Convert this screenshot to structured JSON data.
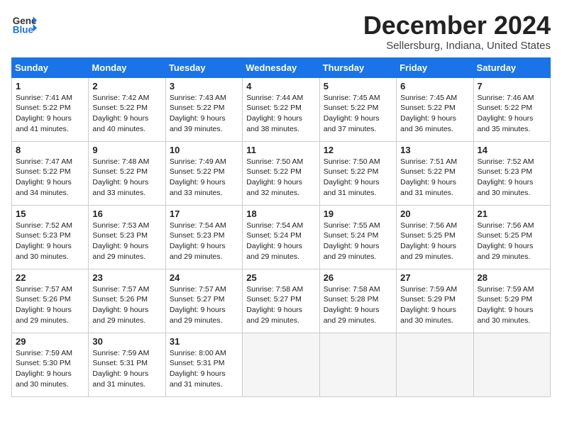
{
  "header": {
    "logo_line1": "General",
    "logo_line2": "Blue",
    "month": "December 2024",
    "location": "Sellersburg, Indiana, United States"
  },
  "weekdays": [
    "Sunday",
    "Monday",
    "Tuesday",
    "Wednesday",
    "Thursday",
    "Friday",
    "Saturday"
  ],
  "weeks": [
    [
      {
        "day": "1",
        "lines": [
          "Sunrise: 7:41 AM",
          "Sunset: 5:22 PM",
          "Daylight: 9 hours",
          "and 41 minutes."
        ]
      },
      {
        "day": "2",
        "lines": [
          "Sunrise: 7:42 AM",
          "Sunset: 5:22 PM",
          "Daylight: 9 hours",
          "and 40 minutes."
        ]
      },
      {
        "day": "3",
        "lines": [
          "Sunrise: 7:43 AM",
          "Sunset: 5:22 PM",
          "Daylight: 9 hours",
          "and 39 minutes."
        ]
      },
      {
        "day": "4",
        "lines": [
          "Sunrise: 7:44 AM",
          "Sunset: 5:22 PM",
          "Daylight: 9 hours",
          "and 38 minutes."
        ]
      },
      {
        "day": "5",
        "lines": [
          "Sunrise: 7:45 AM",
          "Sunset: 5:22 PM",
          "Daylight: 9 hours",
          "and 37 minutes."
        ]
      },
      {
        "day": "6",
        "lines": [
          "Sunrise: 7:45 AM",
          "Sunset: 5:22 PM",
          "Daylight: 9 hours",
          "and 36 minutes."
        ]
      },
      {
        "day": "7",
        "lines": [
          "Sunrise: 7:46 AM",
          "Sunset: 5:22 PM",
          "Daylight: 9 hours",
          "and 35 minutes."
        ]
      }
    ],
    [
      {
        "day": "8",
        "lines": [
          "Sunrise: 7:47 AM",
          "Sunset: 5:22 PM",
          "Daylight: 9 hours",
          "and 34 minutes."
        ]
      },
      {
        "day": "9",
        "lines": [
          "Sunrise: 7:48 AM",
          "Sunset: 5:22 PM",
          "Daylight: 9 hours",
          "and 33 minutes."
        ]
      },
      {
        "day": "10",
        "lines": [
          "Sunrise: 7:49 AM",
          "Sunset: 5:22 PM",
          "Daylight: 9 hours",
          "and 33 minutes."
        ]
      },
      {
        "day": "11",
        "lines": [
          "Sunrise: 7:50 AM",
          "Sunset: 5:22 PM",
          "Daylight: 9 hours",
          "and 32 minutes."
        ]
      },
      {
        "day": "12",
        "lines": [
          "Sunrise: 7:50 AM",
          "Sunset: 5:22 PM",
          "Daylight: 9 hours",
          "and 31 minutes."
        ]
      },
      {
        "day": "13",
        "lines": [
          "Sunrise: 7:51 AM",
          "Sunset: 5:22 PM",
          "Daylight: 9 hours",
          "and 31 minutes."
        ]
      },
      {
        "day": "14",
        "lines": [
          "Sunrise: 7:52 AM",
          "Sunset: 5:23 PM",
          "Daylight: 9 hours",
          "and 30 minutes."
        ]
      }
    ],
    [
      {
        "day": "15",
        "lines": [
          "Sunrise: 7:52 AM",
          "Sunset: 5:23 PM",
          "Daylight: 9 hours",
          "and 30 minutes."
        ]
      },
      {
        "day": "16",
        "lines": [
          "Sunrise: 7:53 AM",
          "Sunset: 5:23 PM",
          "Daylight: 9 hours",
          "and 29 minutes."
        ]
      },
      {
        "day": "17",
        "lines": [
          "Sunrise: 7:54 AM",
          "Sunset: 5:23 PM",
          "Daylight: 9 hours",
          "and 29 minutes."
        ]
      },
      {
        "day": "18",
        "lines": [
          "Sunrise: 7:54 AM",
          "Sunset: 5:24 PM",
          "Daylight: 9 hours",
          "and 29 minutes."
        ]
      },
      {
        "day": "19",
        "lines": [
          "Sunrise: 7:55 AM",
          "Sunset: 5:24 PM",
          "Daylight: 9 hours",
          "and 29 minutes."
        ]
      },
      {
        "day": "20",
        "lines": [
          "Sunrise: 7:56 AM",
          "Sunset: 5:25 PM",
          "Daylight: 9 hours",
          "and 29 minutes."
        ]
      },
      {
        "day": "21",
        "lines": [
          "Sunrise: 7:56 AM",
          "Sunset: 5:25 PM",
          "Daylight: 9 hours",
          "and 29 minutes."
        ]
      }
    ],
    [
      {
        "day": "22",
        "lines": [
          "Sunrise: 7:57 AM",
          "Sunset: 5:26 PM",
          "Daylight: 9 hours",
          "and 29 minutes."
        ]
      },
      {
        "day": "23",
        "lines": [
          "Sunrise: 7:57 AM",
          "Sunset: 5:26 PM",
          "Daylight: 9 hours",
          "and 29 minutes."
        ]
      },
      {
        "day": "24",
        "lines": [
          "Sunrise: 7:57 AM",
          "Sunset: 5:27 PM",
          "Daylight: 9 hours",
          "and 29 minutes."
        ]
      },
      {
        "day": "25",
        "lines": [
          "Sunrise: 7:58 AM",
          "Sunset: 5:27 PM",
          "Daylight: 9 hours",
          "and 29 minutes."
        ]
      },
      {
        "day": "26",
        "lines": [
          "Sunrise: 7:58 AM",
          "Sunset: 5:28 PM",
          "Daylight: 9 hours",
          "and 29 minutes."
        ]
      },
      {
        "day": "27",
        "lines": [
          "Sunrise: 7:59 AM",
          "Sunset: 5:29 PM",
          "Daylight: 9 hours",
          "and 30 minutes."
        ]
      },
      {
        "day": "28",
        "lines": [
          "Sunrise: 7:59 AM",
          "Sunset: 5:29 PM",
          "Daylight: 9 hours",
          "and 30 minutes."
        ]
      }
    ],
    [
      {
        "day": "29",
        "lines": [
          "Sunrise: 7:59 AM",
          "Sunset: 5:30 PM",
          "Daylight: 9 hours",
          "and 30 minutes."
        ]
      },
      {
        "day": "30",
        "lines": [
          "Sunrise: 7:59 AM",
          "Sunset: 5:31 PM",
          "Daylight: 9 hours",
          "and 31 minutes."
        ]
      },
      {
        "day": "31",
        "lines": [
          "Sunrise: 8:00 AM",
          "Sunset: 5:31 PM",
          "Daylight: 9 hours",
          "and 31 minutes."
        ]
      },
      null,
      null,
      null,
      null
    ]
  ]
}
